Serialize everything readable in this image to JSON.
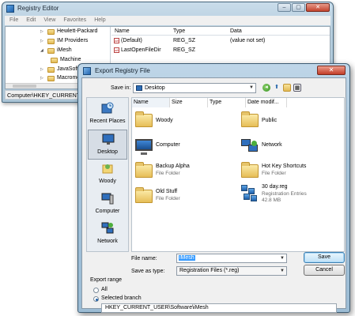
{
  "regedit": {
    "title": "Registry Editor",
    "window_buttons": [
      "–",
      "▢",
      "✕"
    ],
    "menu": [
      "File",
      "Edit",
      "View",
      "Favorites",
      "Help"
    ],
    "tree": [
      {
        "label": "Hewlett-Packard"
      },
      {
        "label": "IM Providers"
      },
      {
        "label": "iMesh"
      },
      {
        "label": "Machine"
      },
      {
        "label": "JavaSoft"
      },
      {
        "label": "Macrome"
      }
    ],
    "columns": [
      "Name",
      "Type",
      "Data"
    ],
    "rows": [
      {
        "name": "(Default)",
        "type": "REG_SZ",
        "data": "(value not set)"
      },
      {
        "name": "LastOpenFileDir",
        "type": "REG_SZ",
        "data": ""
      }
    ],
    "status": "Computer\\HKEY_CURRENT_"
  },
  "dialog": {
    "title": "Export Registry File",
    "close_label": "✕",
    "save_in_label": "Save in:",
    "save_in_value": "Desktop",
    "places": [
      "Recent Places",
      "Desktop",
      "Woody",
      "Computer",
      "Network"
    ],
    "columns": [
      "Name",
      "Size",
      "Type",
      "Date modif..."
    ],
    "items": [
      {
        "name": "Woody",
        "sub1": "",
        "sub2": "",
        "icon": "folder-icon"
      },
      {
        "name": "Public",
        "sub1": "",
        "sub2": "",
        "icon": "folder-icon"
      },
      {
        "name": "Computer",
        "sub1": "",
        "sub2": "",
        "icon": "computer-icon"
      },
      {
        "name": "Network",
        "sub1": "",
        "sub2": "",
        "icon": "network-icon"
      },
      {
        "name": "Backup Alpha",
        "sub1": "File Folder",
        "sub2": "",
        "icon": "folder-icon"
      },
      {
        "name": "Hot Key Shortcuts",
        "sub1": "File Folder",
        "sub2": "",
        "icon": "folder-icon"
      },
      {
        "name": "Old Stuff",
        "sub1": "File Folder",
        "sub2": "",
        "icon": "folder-icon"
      },
      {
        "name": "30 day.reg",
        "sub1": "Registration Entries",
        "sub2": "42.8 MB",
        "icon": "reg-file-icon"
      }
    ],
    "file_name_label": "File name:",
    "file_name_value": "iMesh",
    "save_as_type_label": "Save as type:",
    "save_as_type_value": "Registration Files (*.reg)",
    "save_label": "Save",
    "cancel_label": "Cancel",
    "export_range_title": "Export range",
    "range_all": "All",
    "range_selected": "Selected branch",
    "branch_value": "HKEY_CURRENT_USER\\Software\\iMesh"
  },
  "colors": {
    "accent": "#3399ff",
    "title_bar": "#a4c2d9"
  }
}
